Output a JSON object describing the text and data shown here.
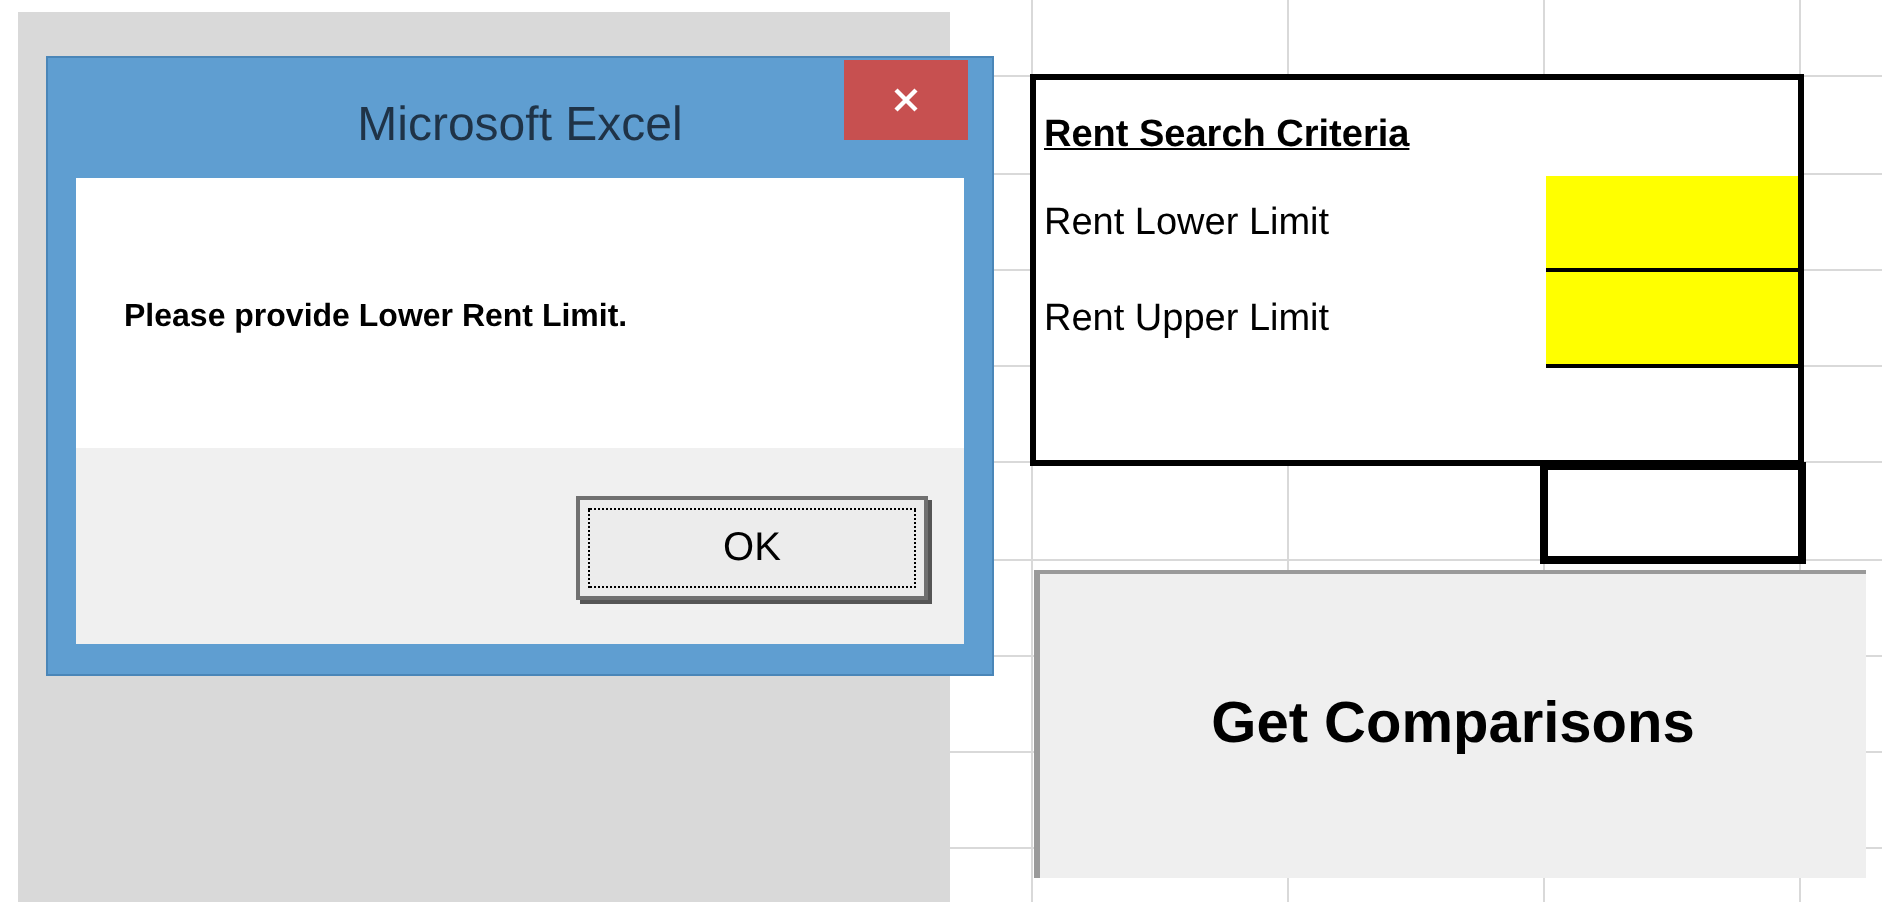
{
  "dialog": {
    "title": "Microsoft Excel",
    "message": "Please provide Lower Rent Limit.",
    "buttons": [
      {
        "label": "OK",
        "focused": true
      }
    ]
  },
  "criteria": {
    "title": "Rent Search Criteria",
    "rows": [
      {
        "label": "Rent Lower Limit"
      },
      {
        "label": "Rent Upper Limit"
      }
    ]
  },
  "action_button": {
    "label": "Get Comparisons"
  }
}
